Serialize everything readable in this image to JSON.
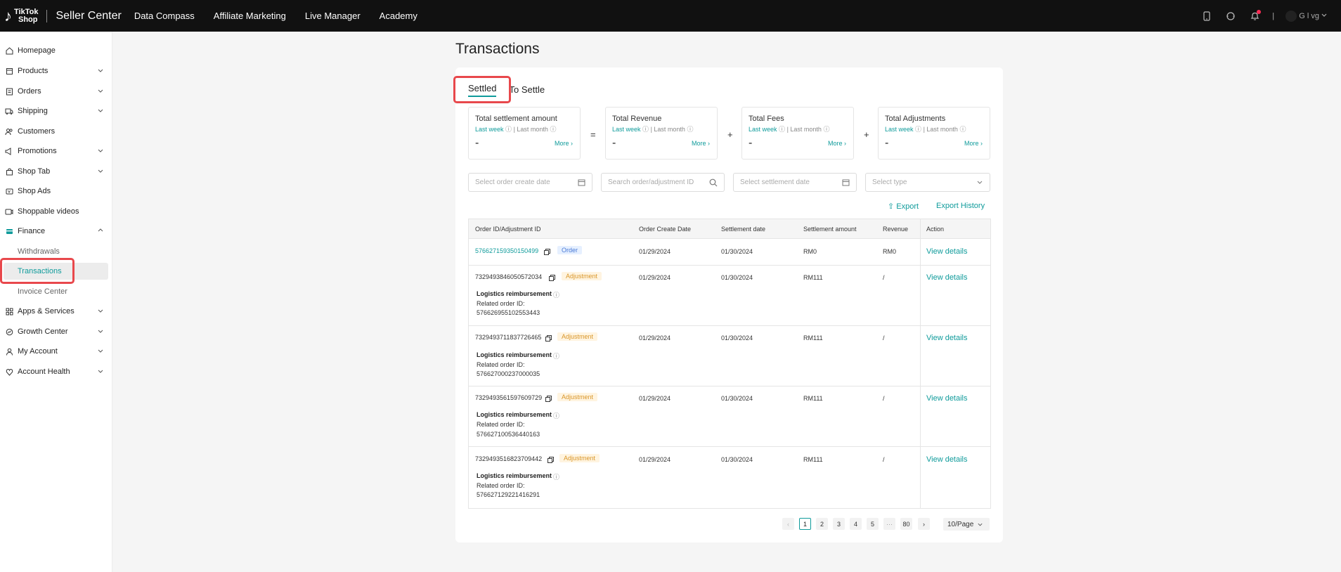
{
  "topbar": {
    "logo_line1": "TikTok",
    "logo_line2": "Shop",
    "app_title": "Seller Center",
    "nav": [
      "Data Compass",
      "Affiliate Marketing",
      "Live Manager",
      "Academy"
    ],
    "user_label": "G l vg",
    "user_divider": "|"
  },
  "sidebar": {
    "items": [
      {
        "label": "Homepage"
      },
      {
        "label": "Products"
      },
      {
        "label": "Orders"
      },
      {
        "label": "Shipping"
      },
      {
        "label": "Customers"
      },
      {
        "label": "Promotions"
      },
      {
        "label": "Shop Tab"
      },
      {
        "label": "Shop Ads"
      },
      {
        "label": "Shoppable videos"
      },
      {
        "label": "Finance"
      },
      {
        "label": "Withdrawals"
      },
      {
        "label": "Transactions"
      },
      {
        "label": "Invoice Center"
      },
      {
        "label": "Apps & Services"
      },
      {
        "label": "Growth Center"
      },
      {
        "label": "My Account"
      },
      {
        "label": "Account Health"
      }
    ]
  },
  "main": {
    "title": "Transactions",
    "tabs": [
      "Settled",
      "To Settle"
    ],
    "metrics": [
      {
        "title": "Total settlement amount",
        "p1": "Last week",
        "p2": "Last month",
        "value": "-",
        "more": "More"
      },
      {
        "title": "Total Revenue",
        "p1": "Last week",
        "p2": "Last month",
        "value": "-",
        "more": "More"
      },
      {
        "title": "Total Fees",
        "p1": "Last week",
        "p2": "Last month",
        "value": "-",
        "more": "More"
      },
      {
        "title": "Total Adjustments",
        "p1": "Last week",
        "p2": "Last month",
        "value": "-",
        "more": "More"
      }
    ],
    "ops": [
      "=",
      "+",
      "+"
    ],
    "filters": {
      "order_date": "Select order create date",
      "search": "Search order/adjustment ID",
      "settle_date": "Select settlement date",
      "type": "Select type"
    },
    "export": "Export",
    "export_history": "Export History",
    "table": {
      "headers": [
        "Order ID/Adjustment ID",
        "Order Create Date",
        "Settlement date",
        "Settlement amount",
        "Revenue",
        "Action"
      ],
      "rows": [
        {
          "id": "576627159350150499",
          "badge": "Order",
          "create": "01/29/2024",
          "settle": "01/30/2024",
          "amount": "RM0",
          "revenue": "RM0",
          "action": "View details"
        },
        {
          "id": "7329493846050572034",
          "badge": "Adjustment",
          "create": "01/29/2024",
          "settle": "01/30/2024",
          "amount": "RM111",
          "revenue": "/",
          "action": "View details",
          "desc": "Logistics reimbursement",
          "related_label": "Related order ID:",
          "related_id": "576626955102553443"
        },
        {
          "id": "7329493711837726465",
          "badge": "Adjustment",
          "create": "01/29/2024",
          "settle": "01/30/2024",
          "amount": "RM111",
          "revenue": "/",
          "action": "View details",
          "desc": "Logistics reimbursement",
          "related_label": "Related order ID:",
          "related_id": "576627000237000035"
        },
        {
          "id": "7329493561597609729",
          "badge": "Adjustment",
          "create": "01/29/2024",
          "settle": "01/30/2024",
          "amount": "RM111",
          "revenue": "/",
          "action": "View details",
          "desc": "Logistics reimbursement",
          "related_label": "Related order ID:",
          "related_id": "576627100536440163"
        },
        {
          "id": "7329493516823709442",
          "badge": "Adjustment",
          "create": "01/29/2024",
          "settle": "01/30/2024",
          "amount": "RM111",
          "revenue": "/",
          "action": "View details",
          "desc": "Logistics reimbursement",
          "related_label": "Related order ID:",
          "related_id": "576627129221416291"
        }
      ]
    },
    "pagination": {
      "pages": [
        "1",
        "2",
        "3",
        "4",
        "5",
        "···",
        "80"
      ],
      "current": "1",
      "page_size": "10/Page",
      "prev": "‹",
      "next": "›"
    }
  },
  "colors": {
    "accent": "#0f9b9b",
    "highlight": "#e8484c",
    "topbar": "#111111"
  }
}
